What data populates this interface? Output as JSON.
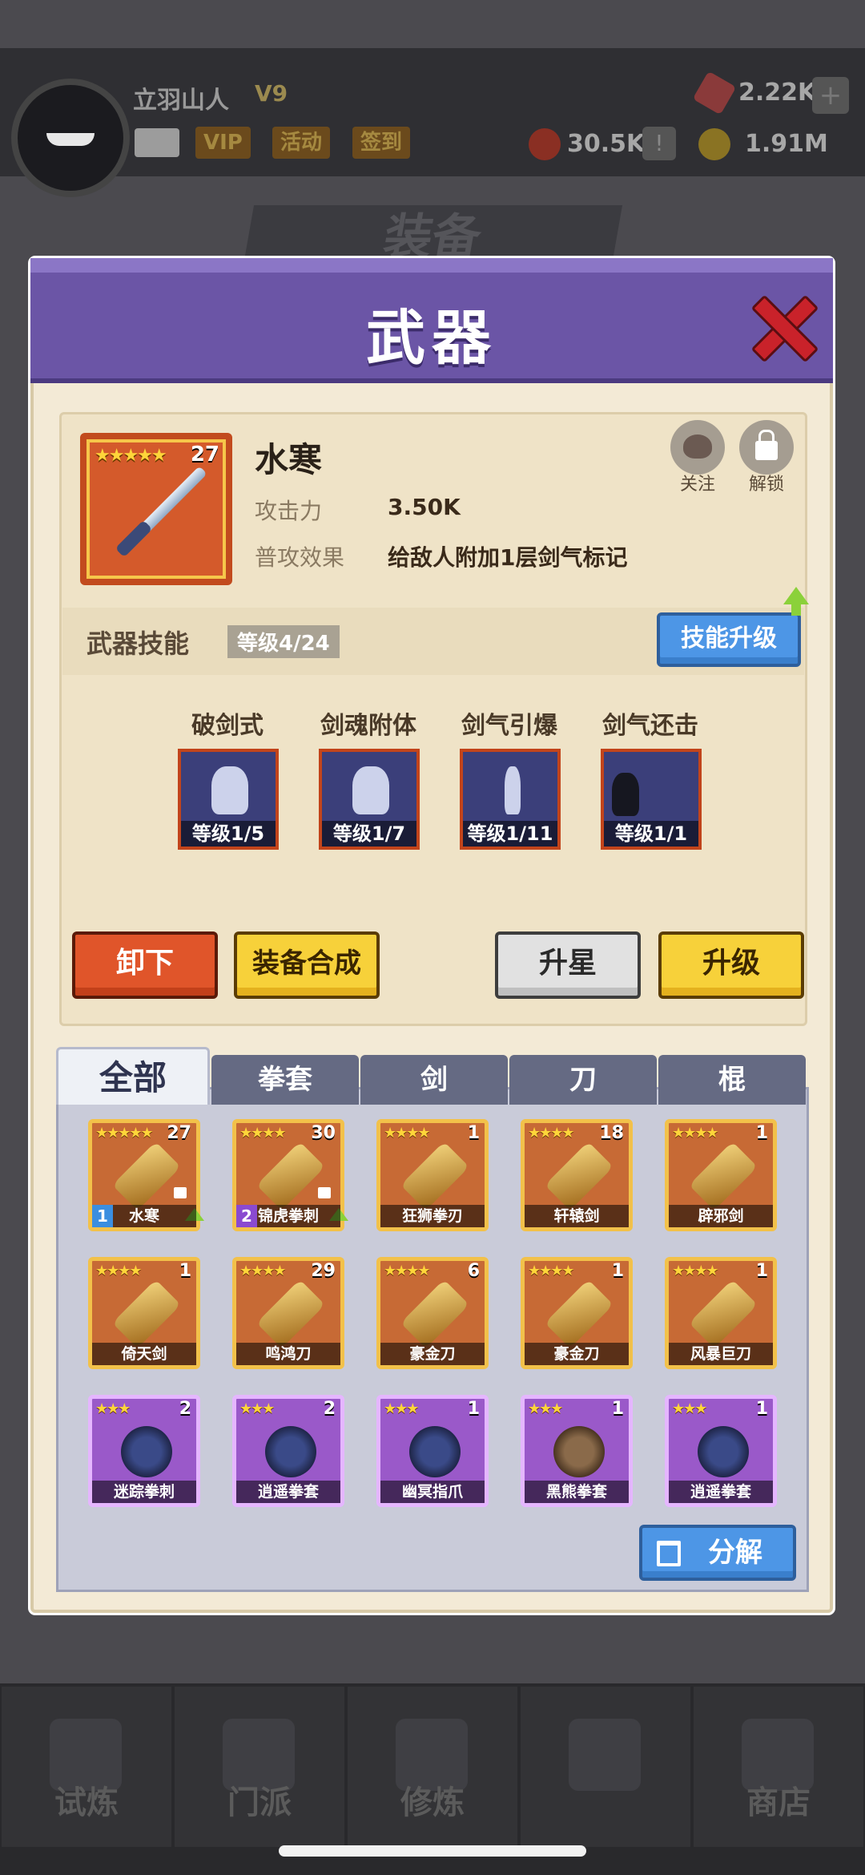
{
  "player": {
    "name": "立羽山人",
    "vip_level": "V9",
    "tags": [
      "VIP",
      "活动",
      "签到"
    ]
  },
  "resources": {
    "gems": "2.22K",
    "tokens": "30.5K",
    "gold": "1.91M"
  },
  "background_title": "装备",
  "modal": {
    "title": "武器",
    "weapon": {
      "name": "水寒",
      "stars": "★★★★★",
      "level": "27",
      "attack_label": "攻击力",
      "attack_value": "3.50K",
      "effect_label": "普攻效果",
      "effect_value": "给敌人附加1层剑气标记",
      "follow_label": "关注",
      "unlock_label": "解锁"
    },
    "skills_section": {
      "title": "武器技能",
      "level": "等级4/24",
      "upgrade_button": "技能升级",
      "skills": [
        {
          "name": "破剑式",
          "level": "等级1/5"
        },
        {
          "name": "剑魂附体",
          "level": "等级1/7"
        },
        {
          "name": "剑气引爆",
          "level": "等级1/11"
        },
        {
          "name": "剑气还击",
          "level": "等级1/1"
        }
      ]
    },
    "actions": {
      "unequip": "卸下",
      "synthesize": "装备合成",
      "star_up": "升星",
      "level_up": "升级"
    },
    "tabs": [
      "全部",
      "拳套",
      "剑",
      "刀",
      "棍"
    ],
    "items": [
      {
        "name": "水寒",
        "stars": "★★★★★",
        "count": "27",
        "equipped": "1",
        "rarity": "orange"
      },
      {
        "name": "锦虎拳刺",
        "stars": "★★★★",
        "count": "30",
        "equipped": "2",
        "rarity": "orange"
      },
      {
        "name": "狂狮拳刃",
        "stars": "★★★★",
        "count": "1",
        "rarity": "orange"
      },
      {
        "name": "轩辕剑",
        "stars": "★★★★",
        "count": "18",
        "rarity": "orange"
      },
      {
        "name": "辟邪剑",
        "stars": "★★★★",
        "count": "1",
        "rarity": "orange"
      },
      {
        "name": "倚天剑",
        "stars": "★★★★",
        "count": "1",
        "rarity": "orange"
      },
      {
        "name": "鸣鸿刀",
        "stars": "★★★★",
        "count": "29",
        "rarity": "orange"
      },
      {
        "name": "豪金刀",
        "stars": "★★★★",
        "count": "6",
        "rarity": "orange"
      },
      {
        "name": "豪金刀",
        "stars": "★★★★",
        "count": "1",
        "rarity": "orange"
      },
      {
        "name": "风暴巨刀",
        "stars": "★★★★",
        "count": "1",
        "rarity": "orange"
      },
      {
        "name": "迷踪拳刺",
        "stars": "★★★",
        "count": "2",
        "rarity": "purple"
      },
      {
        "name": "逍遥拳套",
        "stars": "★★★",
        "count": "2",
        "rarity": "purple"
      },
      {
        "name": "幽冥指爪",
        "stars": "★★★",
        "count": "1",
        "rarity": "purple"
      },
      {
        "name": "黑熊拳套",
        "stars": "★★★",
        "count": "1",
        "rarity": "purple"
      },
      {
        "name": "逍遥拳套",
        "stars": "★★★",
        "count": "1",
        "rarity": "purple"
      }
    ],
    "decompose_button": "分解"
  },
  "nav": [
    "试炼",
    "门派",
    "修炼",
    "",
    "商店"
  ],
  "colors": {
    "header": "#6b55a6",
    "panel": "#f3ead6",
    "accent_blue": "#4d96e6",
    "accent_yellow": "#f7d13a",
    "accent_red": "#e0552a"
  }
}
